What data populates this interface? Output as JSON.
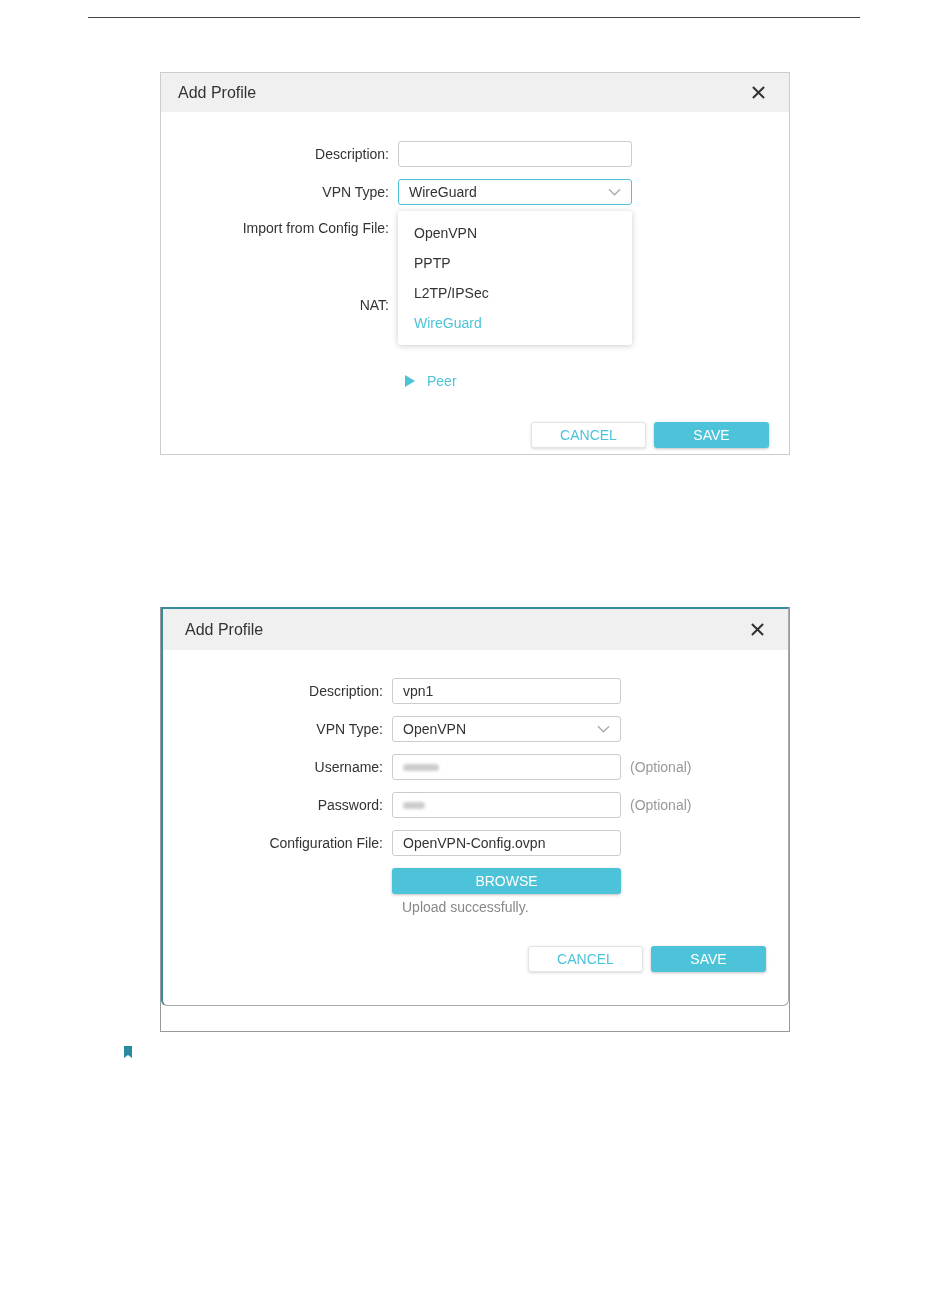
{
  "dialogs": [
    {
      "title": "Add Profile",
      "fields": [
        {
          "kind": "text",
          "label": "Description:",
          "focused": false
        },
        {
          "kind": "select",
          "label": "VPN Type:",
          "value": "WireGuard",
          "focused": true
        },
        {
          "kind": "tall",
          "label": "Import from Config File:"
        },
        {
          "kind": "plain",
          "label": "NAT:"
        }
      ],
      "dropdown": {
        "options": [
          {
            "label": "OpenVPN",
            "selected": false
          },
          {
            "label": "PPTP",
            "selected": false
          },
          {
            "label": "L2TP/IPSec",
            "selected": false
          },
          {
            "label": "WireGuard",
            "selected": true
          }
        ]
      },
      "sections": [
        {
          "label": "Peer",
          "expanded": false
        }
      ],
      "buttons": [
        {
          "label": "CANCEL",
          "kind": "secondary"
        },
        {
          "label": "SAVE",
          "kind": "primary"
        }
      ]
    },
    {
      "title": "Add Profile",
      "fields": [
        {
          "kind": "text",
          "label": "Description:",
          "value": "vpn1",
          "focused": false
        },
        {
          "kind": "select",
          "label": "VPN Type:",
          "value": "OpenVPN",
          "focused": false
        },
        {
          "kind": "blurred",
          "label": "Username:",
          "hint": "(Optional)"
        },
        {
          "kind": "blurred",
          "label": "Password:",
          "hint": "(Optional)"
        },
        {
          "kind": "text",
          "label": "Configuration File:",
          "value": "OpenVPN-Config.ovpn",
          "focused": false
        }
      ],
      "browse": {
        "label": "BROWSE",
        "status": "Upload successfully."
      },
      "buttons": [
        {
          "label": "CANCEL",
          "kind": "secondary"
        },
        {
          "label": "SAVE",
          "kind": "primary"
        }
      ]
    }
  ]
}
